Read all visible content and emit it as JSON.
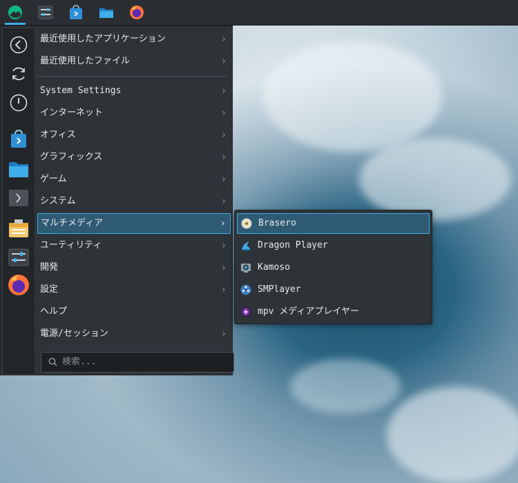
{
  "taskbar": {
    "items": [
      {
        "name": "application-launcher",
        "icon": "rocky-logo-icon"
      },
      {
        "name": "system-settings",
        "icon": "settings-sliders-icon"
      },
      {
        "name": "discover",
        "icon": "store-bag-icon"
      },
      {
        "name": "file-manager",
        "icon": "folder-icon"
      },
      {
        "name": "firefox",
        "icon": "firefox-icon"
      }
    ]
  },
  "favorites": {
    "items": [
      {
        "name": "back",
        "icon": "back-arrow-icon"
      },
      {
        "name": "restart",
        "icon": "restart-icon"
      },
      {
        "name": "shutdown",
        "icon": "power-icon"
      },
      {
        "name": "discover",
        "icon": "store-bag-icon"
      },
      {
        "name": "files",
        "icon": "folder-icon"
      },
      {
        "name": "terminal",
        "icon": "terminal-icon"
      },
      {
        "name": "archive",
        "icon": "archive-icon"
      },
      {
        "name": "settings",
        "icon": "settings-sliders-icon"
      },
      {
        "name": "firefox",
        "icon": "firefox-icon"
      }
    ]
  },
  "menu": {
    "recent": [
      {
        "label": "最近使用したアプリケーション"
      },
      {
        "label": "最近使用したファイル"
      }
    ],
    "categories": [
      {
        "label": "System Settings"
      },
      {
        "label": "インターネット"
      },
      {
        "label": "オフィス"
      },
      {
        "label": "グラフィックス"
      },
      {
        "label": "ゲーム"
      },
      {
        "label": "システム"
      },
      {
        "label": "マルチメディア"
      },
      {
        "label": "ユーティリティ"
      },
      {
        "label": "開発"
      },
      {
        "label": "設定"
      },
      {
        "label": "ヘルプ"
      },
      {
        "label": "電源/セッション"
      }
    ],
    "chevron": "›"
  },
  "search": {
    "placeholder": "検索..."
  },
  "submenu": {
    "items": [
      {
        "label": "Brasero",
        "icon": "disc-icon"
      },
      {
        "label": "Dragon Player",
        "icon": "dragon-icon"
      },
      {
        "label": "Kamoso",
        "icon": "webcam-icon"
      },
      {
        "label": "SMPlayer",
        "icon": "film-reel-icon"
      },
      {
        "label": "mpv メディアプレイヤー",
        "icon": "mpv-play-icon"
      }
    ]
  },
  "colors": {
    "accent": "#3daee9",
    "highlight": "#2f5a73",
    "menu_bg": "#2e3338"
  }
}
